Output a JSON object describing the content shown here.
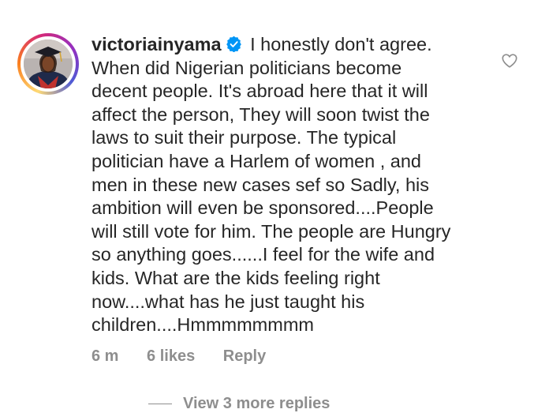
{
  "comment": {
    "username": "victoriainyama",
    "text": "I honestly don't agree. When did Nigerian politicians become decent people.  It's abroad here that it will affect the person,  They will soon twist the laws to suit their purpose. The typical politician have a Harlem of women , and men in these new cases sef so Sadly,  his ambition will even be sponsored....People will still vote for him.  The people are Hungry so anything goes......I feel for the wife and kids.  What are the kids feeling right now....what has he just taught his children....Hmmmmmmmm",
    "time": "6 m",
    "likes": "6 likes",
    "reply_label": "Reply",
    "view_replies": "View 3 more replies"
  },
  "icons": {
    "verified": "verified-badge-icon",
    "like": "heart-outline-icon"
  },
  "colors": {
    "text": "#262626",
    "muted": "#8e8e8e",
    "verified": "#0095f6"
  }
}
